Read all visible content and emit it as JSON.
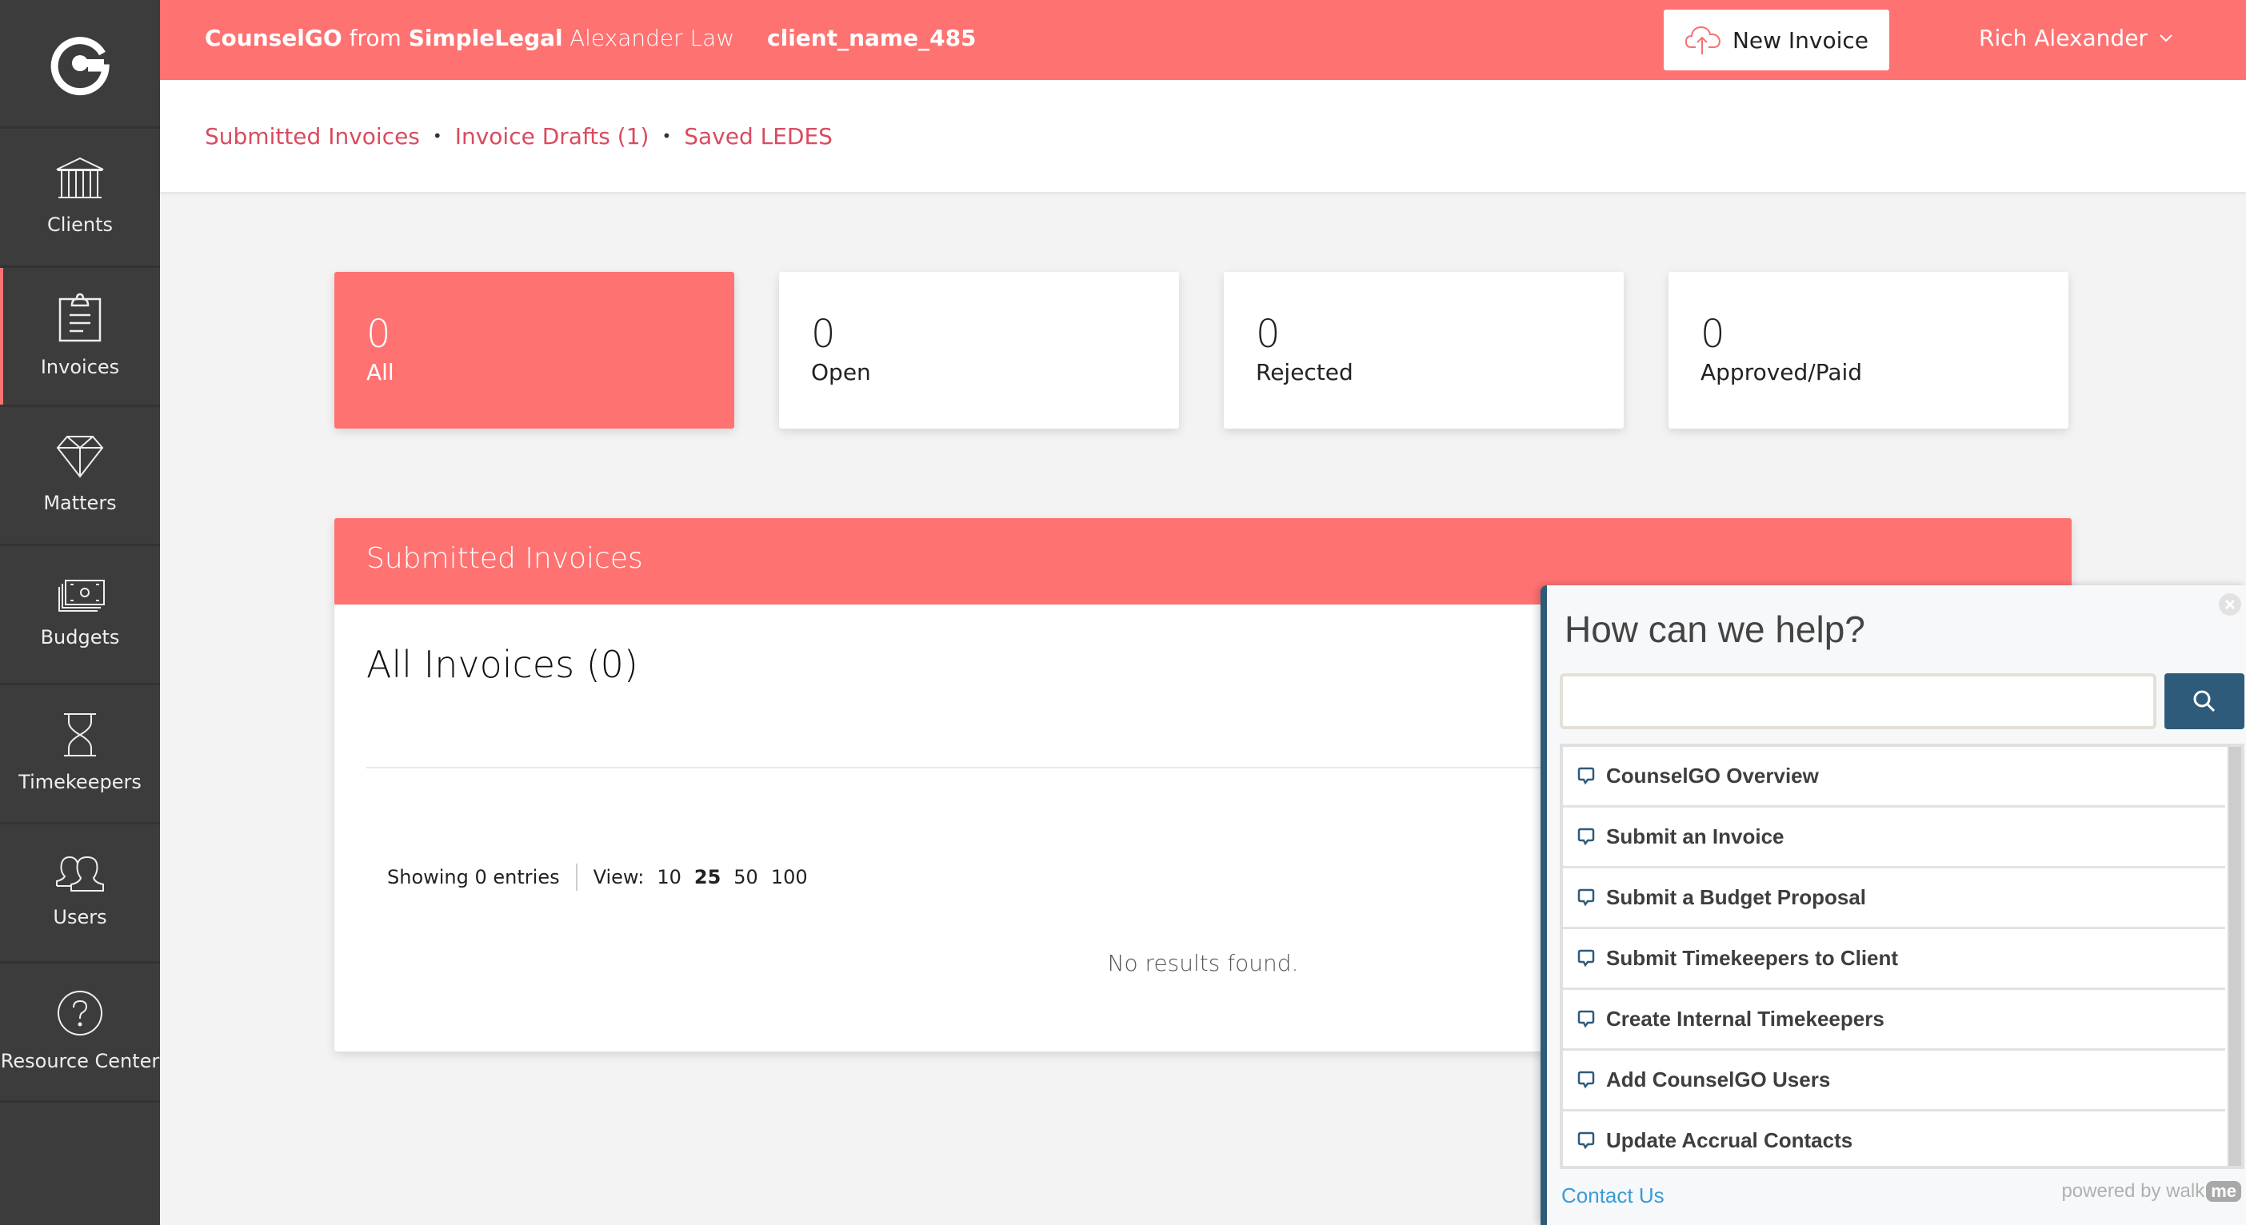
{
  "header": {
    "brand_product": "CounselGO",
    "brand_from": "from",
    "brand_company": "SimpleLegal",
    "firm_name": "Alexander Law",
    "client_name": "client_name_485",
    "new_invoice_label": "New Invoice",
    "user_name": "Rich Alexander"
  },
  "sidebar": {
    "items": [
      {
        "label": "Clients",
        "icon": "bank-icon"
      },
      {
        "label": "Invoices",
        "icon": "clipboard-icon",
        "active": true
      },
      {
        "label": "Matters",
        "icon": "diamond-icon"
      },
      {
        "label": "Budgets",
        "icon": "money-stack-icon"
      },
      {
        "label": "Timekeepers",
        "icon": "hourglass-icon"
      },
      {
        "label": "Users",
        "icon": "users-icon"
      },
      {
        "label": "Resource Center",
        "icon": "help-circle-icon"
      }
    ]
  },
  "subnav": {
    "links": [
      "Submitted Invoices",
      "Invoice Drafts (1)",
      "Saved LEDES"
    ],
    "separator": "•"
  },
  "stats": [
    {
      "count": "0",
      "label": "All",
      "active": true
    },
    {
      "count": "0",
      "label": "Open"
    },
    {
      "count": "0",
      "label": "Rejected"
    },
    {
      "count": "0",
      "label": "Approved/Paid"
    }
  ],
  "panel": {
    "header": "Submitted Invoices",
    "title": "All Invoices (0)",
    "showing": "Showing 0 entries",
    "view_label": "View:",
    "view_options": [
      "10",
      "25",
      "50",
      "100"
    ],
    "view_selected": "25",
    "empty_message": "No results found."
  },
  "help": {
    "title": "How can we help?",
    "search_placeholder": "",
    "items": [
      "CounselGO Overview",
      "Submit an Invoice",
      "Submit a Budget Proposal",
      "Submit Timekeepers to Client",
      "Create Internal Timekeepers",
      "Add CounselGO Users",
      "Update Accrual Contacts"
    ],
    "contact_label": "Contact Us",
    "powered_by": "powered by walk",
    "powered_brand": "me"
  },
  "colors": {
    "accent": "#ff7272",
    "sidebar_bg": "#3c3c3c",
    "link": "#d94b5f",
    "help_accent": "#2e5b7a"
  }
}
